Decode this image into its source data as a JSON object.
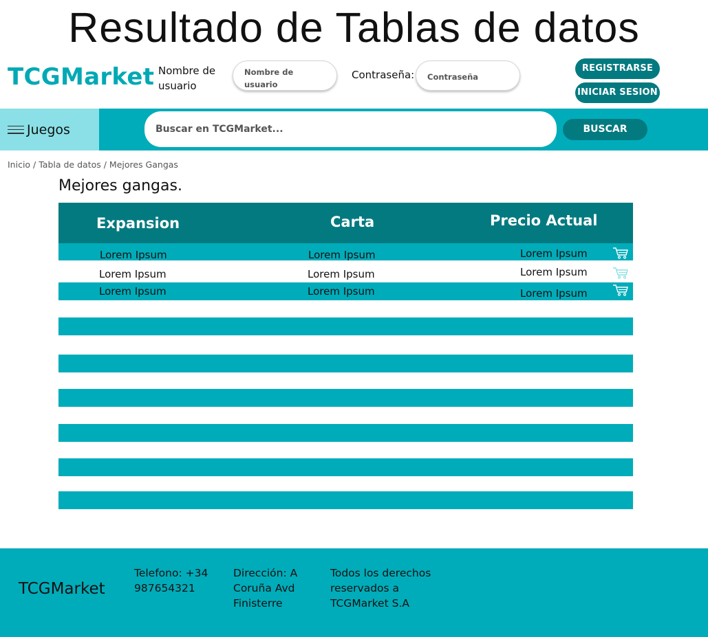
{
  "page_heading": "Resultado de Tablas de datos",
  "header": {
    "logo": "TCGMarket",
    "username_label": "Nombre de usuario",
    "username_placeholder": "Nombre de usuario",
    "password_label": "Contraseña:",
    "password_placeholder": "Contraseña",
    "register_label": "REGISTRARSE",
    "login_label": "INICIAR SESION"
  },
  "navbar": {
    "games_label": "Juegos",
    "search_placeholder": "Buscar en TCGMarket...",
    "search_button": "BUSCAR"
  },
  "breadcrumb": "Inicio / Tabla de datos / Mejores Gangas",
  "section_title": "Mejores gangas.",
  "table": {
    "columns": [
      "Expansion",
      "Carta",
      "Precio Actual"
    ],
    "rows": [
      [
        "Lorem Ipsum",
        "Lorem Ipsum",
        "Lorem Ipsum"
      ],
      [
        "Lorem Ipsum",
        "Lorem Ipsum",
        "Lorem Ipsum"
      ],
      [
        "Lorem Ipsum",
        "Lorem Ipsum",
        "Lorem Ipsum"
      ]
    ],
    "row_icon": "cart-icon"
  },
  "footer": {
    "brand": "TCGMarket",
    "phone": "Telefono: +34 987654321",
    "address": "Dirección: A Coruña Avd Finisterre",
    "rights": "Todos los derechos reservados a TCGMarket S.A"
  },
  "colors": {
    "teal": "#00acba",
    "dark_teal": "#037a80",
    "light_teal": "#8ae0e6",
    "logo": "#00a9b5"
  }
}
